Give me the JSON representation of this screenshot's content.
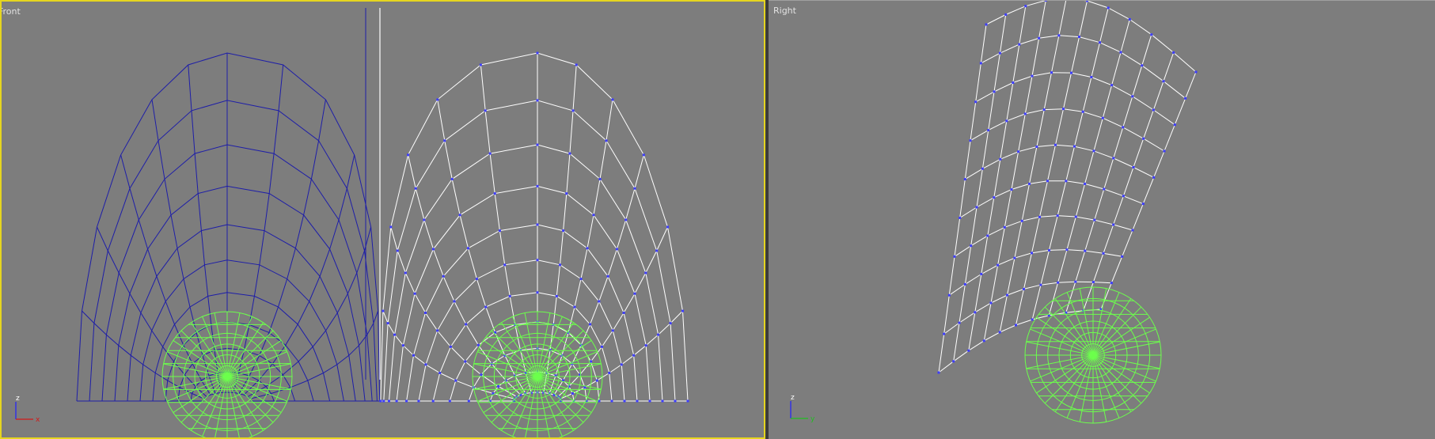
{
  "viewports": {
    "front": {
      "label": "Front",
      "active": true,
      "axes": {
        "vertical": "z",
        "horizontal": "x"
      }
    },
    "right": {
      "label": "Right",
      "active": false,
      "axes": {
        "vertical": "z",
        "horizontal": "y"
      }
    }
  },
  "colors": {
    "background": "#7d7d7d",
    "active_border": "#e5d51f",
    "mesh_selected": "#ffffff",
    "mesh_mirror": "#1e1ea8",
    "eyeball": "#6cff4c",
    "vertex": "#3d3dff",
    "axis_x": "#d21a1a",
    "axis_y": "#1fbf1f",
    "axis_z": "#2020ff"
  },
  "icons": [
    "axis-tripod-icon"
  ]
}
